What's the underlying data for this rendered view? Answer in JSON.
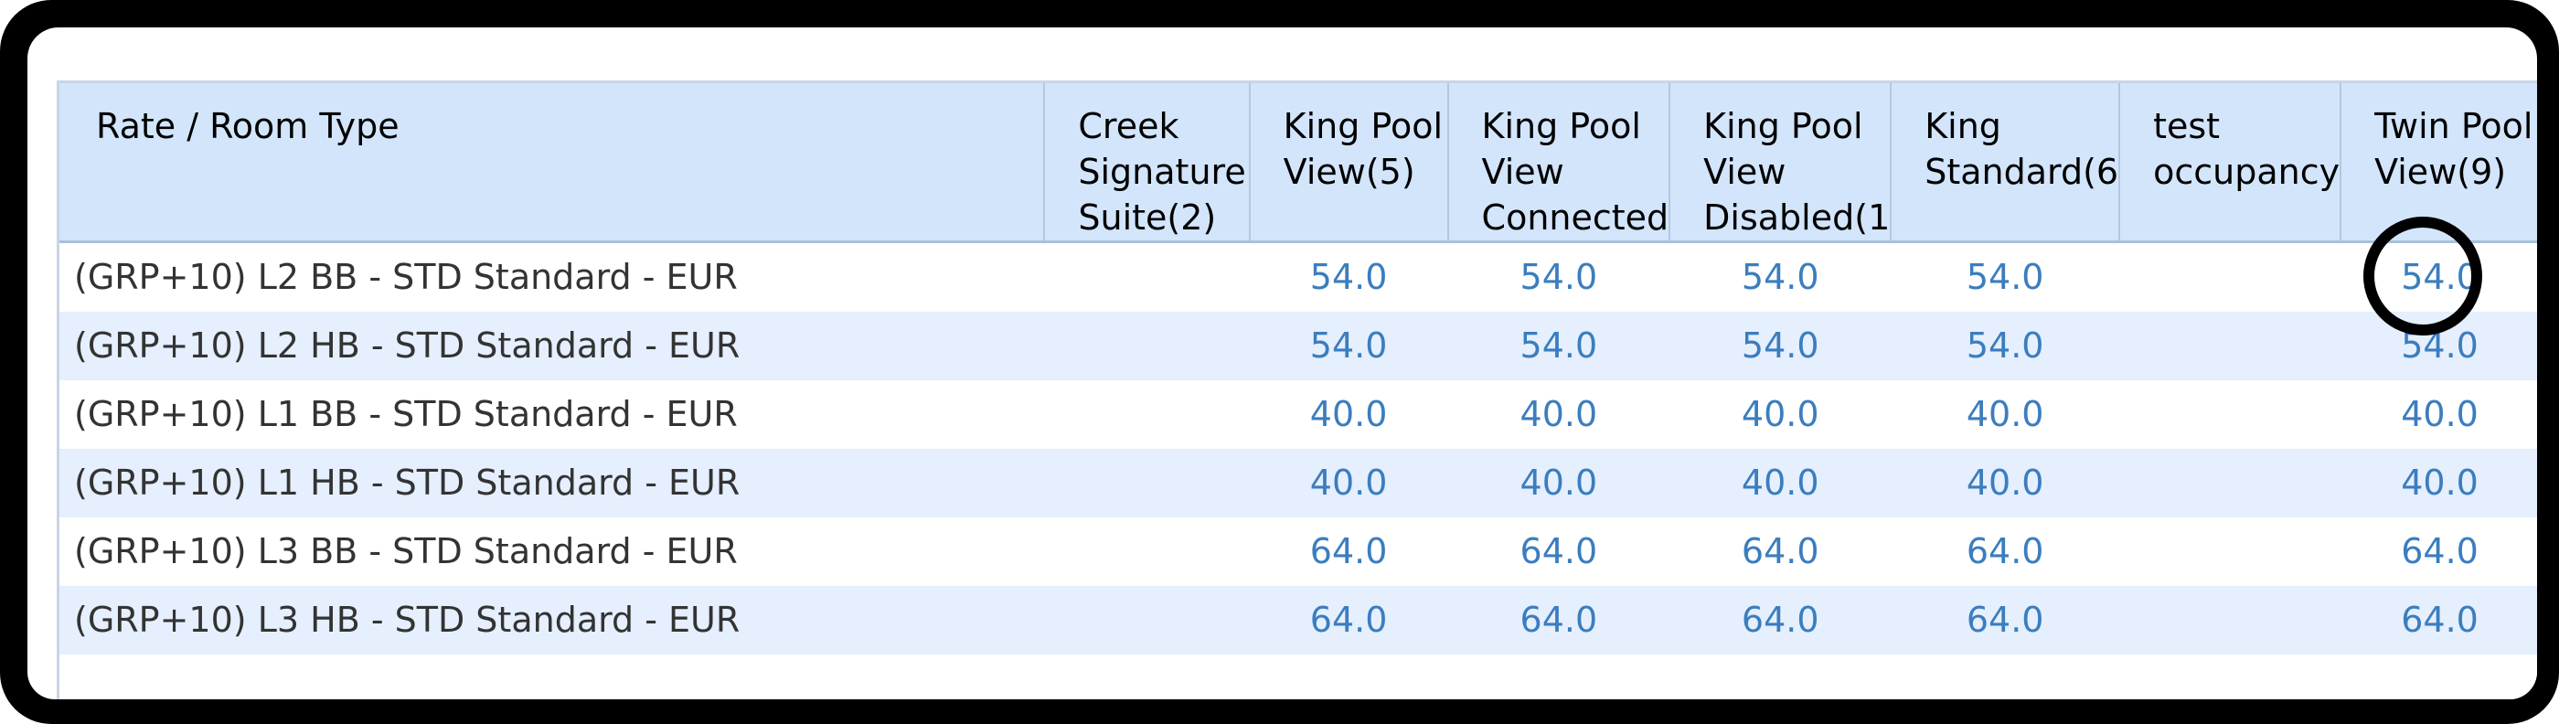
{
  "grid": {
    "columns": [
      "Rate / Room Type",
      "Creek Signature Suite(2)",
      "King Pool View(5)",
      "King Pool View Connected",
      "King Pool View Disabled(1",
      "King Standard(6",
      "test occupancy",
      "Twin Pool View(9)"
    ],
    "rows": [
      {
        "label": "(GRP+10) L2 BB - STD Standard - EUR",
        "values": [
          "",
          "54.0",
          "54.0",
          "54.0",
          "54.0",
          "",
          "54.0"
        ]
      },
      {
        "label": "(GRP+10) L2 HB - STD Standard - EUR",
        "values": [
          "",
          "54.0",
          "54.0",
          "54.0",
          "54.0",
          "",
          "54.0"
        ]
      },
      {
        "label": "(GRP+10) L1 BB - STD Standard - EUR",
        "values": [
          "",
          "40.0",
          "40.0",
          "40.0",
          "40.0",
          "",
          "40.0"
        ]
      },
      {
        "label": "(GRP+10) L1 HB - STD Standard - EUR",
        "values": [
          "",
          "40.0",
          "40.0",
          "40.0",
          "40.0",
          "",
          "40.0"
        ]
      },
      {
        "label": "(GRP+10) L3 BB - STD Standard - EUR",
        "values": [
          "",
          "64.0",
          "64.0",
          "64.0",
          "64.0",
          "",
          "64.0"
        ]
      },
      {
        "label": "(GRP+10) L3 HB - STD Standard - EUR",
        "values": [
          "",
          "64.0",
          "64.0",
          "64.0",
          "64.0",
          "",
          "64.0"
        ]
      }
    ]
  },
  "colors": {
    "header_bg": "#d3e5fb",
    "row_alt_bg": "#e5effd",
    "value_text": "#3b7dbf",
    "frame": "#000000"
  }
}
